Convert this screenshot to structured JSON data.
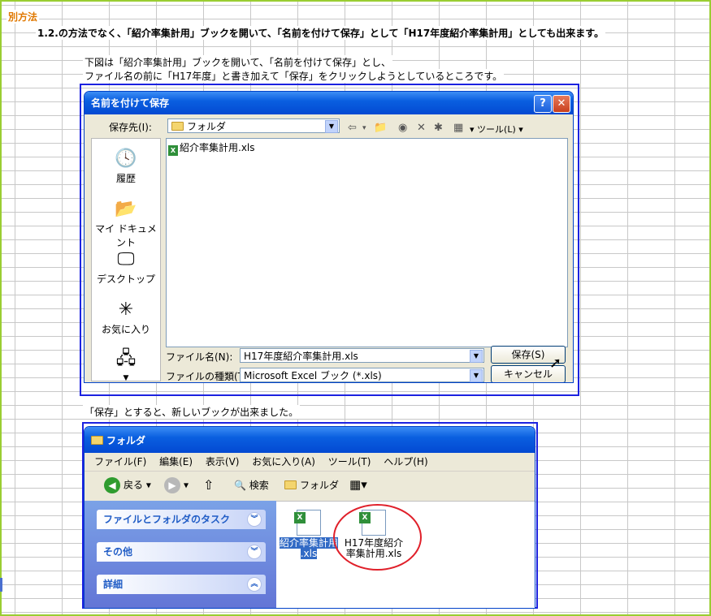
{
  "heading": "別方法",
  "step_text": "1.2.の方法でなく、「紹介率集計用」ブックを開いて、「名前を付けて保存」として「H17年度紹介率集計用」としても出来ます。",
  "caption1_line1": "下図は「紹介率集計用」ブックを開いて、「名前を付けて保存」とし、",
  "caption1_line2": "ファイル名の前に「H17年度」と書き加えて「保存」をクリックしようとしているところです。",
  "caption2": "「保存」とすると、新しいブックが出来ました。",
  "save_dialog": {
    "title": "名前を付けて保存",
    "help_label": "?",
    "close_label": "✕",
    "location_label": "保存先(I):",
    "location_value": "フォルダ",
    "tools_label": "ツール(L)",
    "places": [
      "履歴",
      "マイ ドキュメント",
      "デスクトップ",
      "お気に入り"
    ],
    "files": [
      "紹介率集計用.xls"
    ],
    "filename_label": "ファイル名(N):",
    "filename_value": "H17年度紹介率集計用.xls",
    "filetype_label": "ファイルの種類(T):",
    "filetype_value": "Microsoft Excel ブック (*.xls)",
    "save_button": "保存(S)",
    "cancel_button": "キャンセル"
  },
  "explorer": {
    "title": "フォルダ",
    "menu": [
      "ファイル(F)",
      "編集(E)",
      "表示(V)",
      "お気に入り(A)",
      "ツール(T)",
      "ヘルプ(H)"
    ],
    "back_label": "戻る",
    "search_label": "検索",
    "folder_label": "フォルダ",
    "tasks": [
      "ファイルとフォルダのタスク",
      "その他",
      "詳細"
    ],
    "file1_line1": "紹介率集計用",
    "file1_line2": ".xls",
    "file2_line1": "H17年度紹介",
    "file2_line2": "率集計用.xls"
  },
  "colors": {
    "highlight_border": "#1c22e0",
    "heading": "#e07800",
    "circle": "#e0202a",
    "xp_title": "#0a5fe0"
  }
}
